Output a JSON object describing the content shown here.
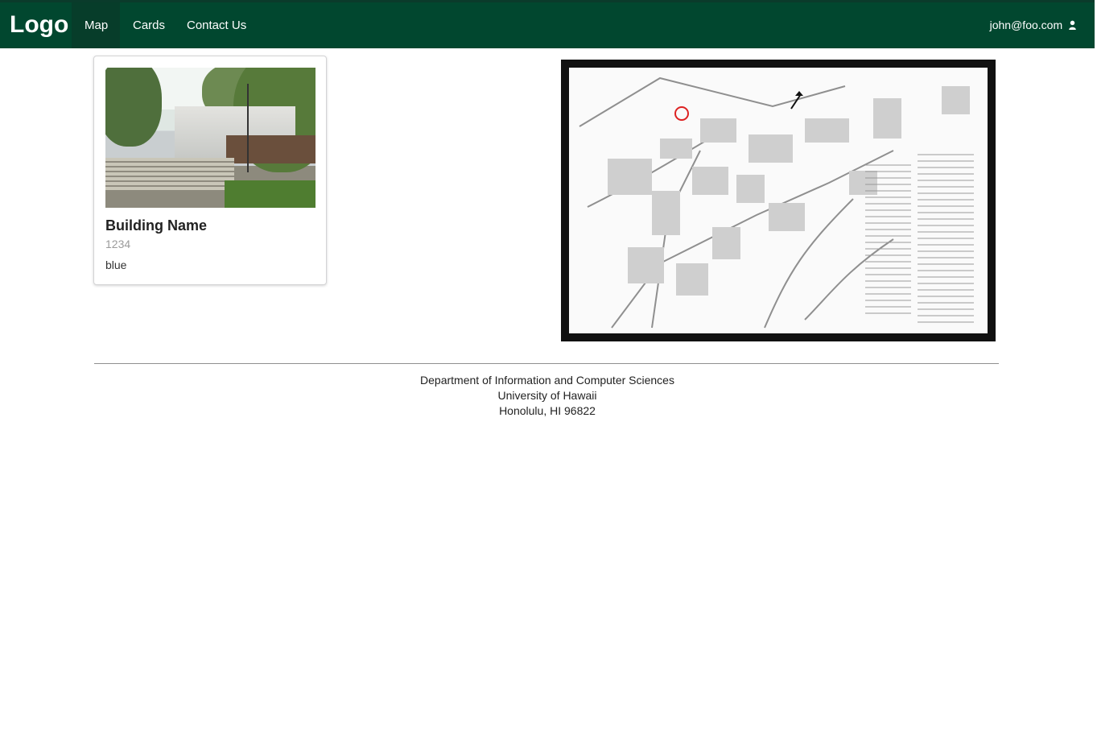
{
  "navbar": {
    "brand": "Logo",
    "items": [
      {
        "label": "Map",
        "active": true
      },
      {
        "label": "Cards",
        "active": false
      },
      {
        "label": "Contact Us",
        "active": false
      }
    ],
    "user": "john@foo.com",
    "user_icon": "user-icon"
  },
  "card": {
    "image_icon": "building-photo",
    "title": "Building Name",
    "number": "1234",
    "description": "blue"
  },
  "map": {
    "icon": "campus-map"
  },
  "footer": {
    "lines": [
      "Department of Information and Computer Sciences",
      "University of Hawaii",
      "Honolulu, HI 96822"
    ]
  },
  "colors": {
    "navbar": "#01472f",
    "active_nav": "#073d2a",
    "text": "#333333",
    "muted": "#9b9b9b"
  }
}
